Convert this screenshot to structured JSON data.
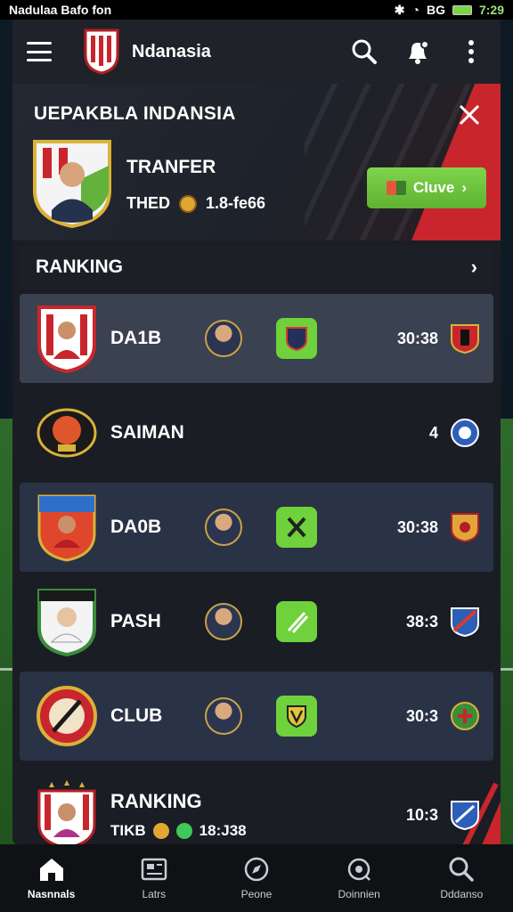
{
  "status_bar": {
    "carrier": "Nadulaa Bafo fon",
    "network": "BG",
    "time": "7:29"
  },
  "app_bar": {
    "title": "Ndanasia"
  },
  "promo": {
    "title": "UEPAKBLA INDANSIA",
    "subtitle": "TRANFER",
    "meta_left": "THED",
    "meta_value": "1.8-fe66",
    "cta_label": "Cluve"
  },
  "ranking_header": {
    "label": "RANKING"
  },
  "rows": [
    {
      "name": "DA1B",
      "score": "30:38",
      "style": "hl"
    },
    {
      "name": "SAIMAN",
      "score": "4",
      "style": "plain"
    },
    {
      "name": "DA0B",
      "score": "30:38",
      "style": "alt"
    },
    {
      "name": "PASH",
      "score": "38:3",
      "style": "plain"
    },
    {
      "name": "CLUB",
      "score": "30:3",
      "style": "alt"
    }
  ],
  "last_row": {
    "name": "RANKING",
    "meta_left": "TIKB",
    "meta_value": "18:J38",
    "score": "10:3"
  },
  "bottom_nav": [
    {
      "label": "Nasnnals",
      "icon": "home-icon"
    },
    {
      "label": "Latrs",
      "icon": "news-icon"
    },
    {
      "label": "Peone",
      "icon": "compass-icon"
    },
    {
      "label": "Doinnien",
      "icon": "settings-icon"
    },
    {
      "label": "Dddanso",
      "icon": "search-icon"
    }
  ],
  "colors": {
    "accent_green": "#6fd13b",
    "accent_red": "#c8262c",
    "panel": "#1a1d24"
  }
}
